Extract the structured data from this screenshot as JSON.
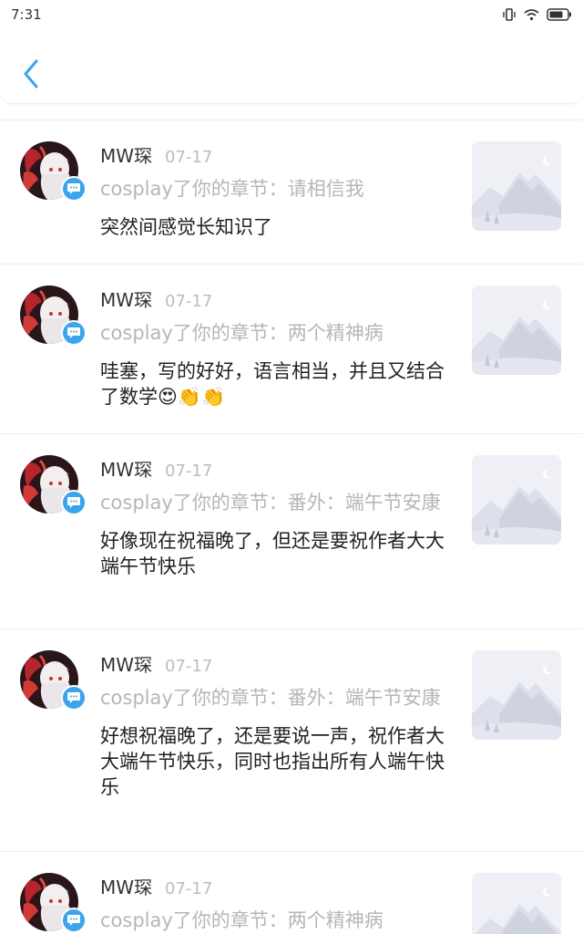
{
  "status_bar": {
    "time": "7:31",
    "icons": [
      "vibrate-icon",
      "wifi-icon",
      "battery-icon"
    ]
  },
  "header": {
    "back_icon": "chevron-left-icon",
    "accent": "#3ba4ee"
  },
  "notifications": [
    {
      "username": "MW琛",
      "date": "07-17",
      "action": "cosplay了你的章节：请相信我",
      "comment": "突然间感觉长知识了",
      "emojis": ""
    },
    {
      "username": "MW琛",
      "date": "07-17",
      "action": "cosplay了你的章节：两个精神病",
      "comment": "哇塞，写的好好，语言相当，并且又结合了数学",
      "emojis": "😍👏👏"
    },
    {
      "username": "MW琛",
      "date": "07-17",
      "action": "cosplay了你的章节：番外：端午节安康",
      "comment": "好像现在祝福晚了，但还是要祝作者大大端午节快乐",
      "emojis": ""
    },
    {
      "username": "MW琛",
      "date": "07-17",
      "action": "cosplay了你的章节：番外：端午节安康",
      "comment": "好想祝福晚了，还是要说一声，祝作者大大端午节快乐，同时也指出所有人端午快乐",
      "emojis": ""
    },
    {
      "username": "MW琛",
      "date": "07-17",
      "action": "cosplay了你的章节：两个精神病",
      "comment": "",
      "emojis": ""
    }
  ]
}
